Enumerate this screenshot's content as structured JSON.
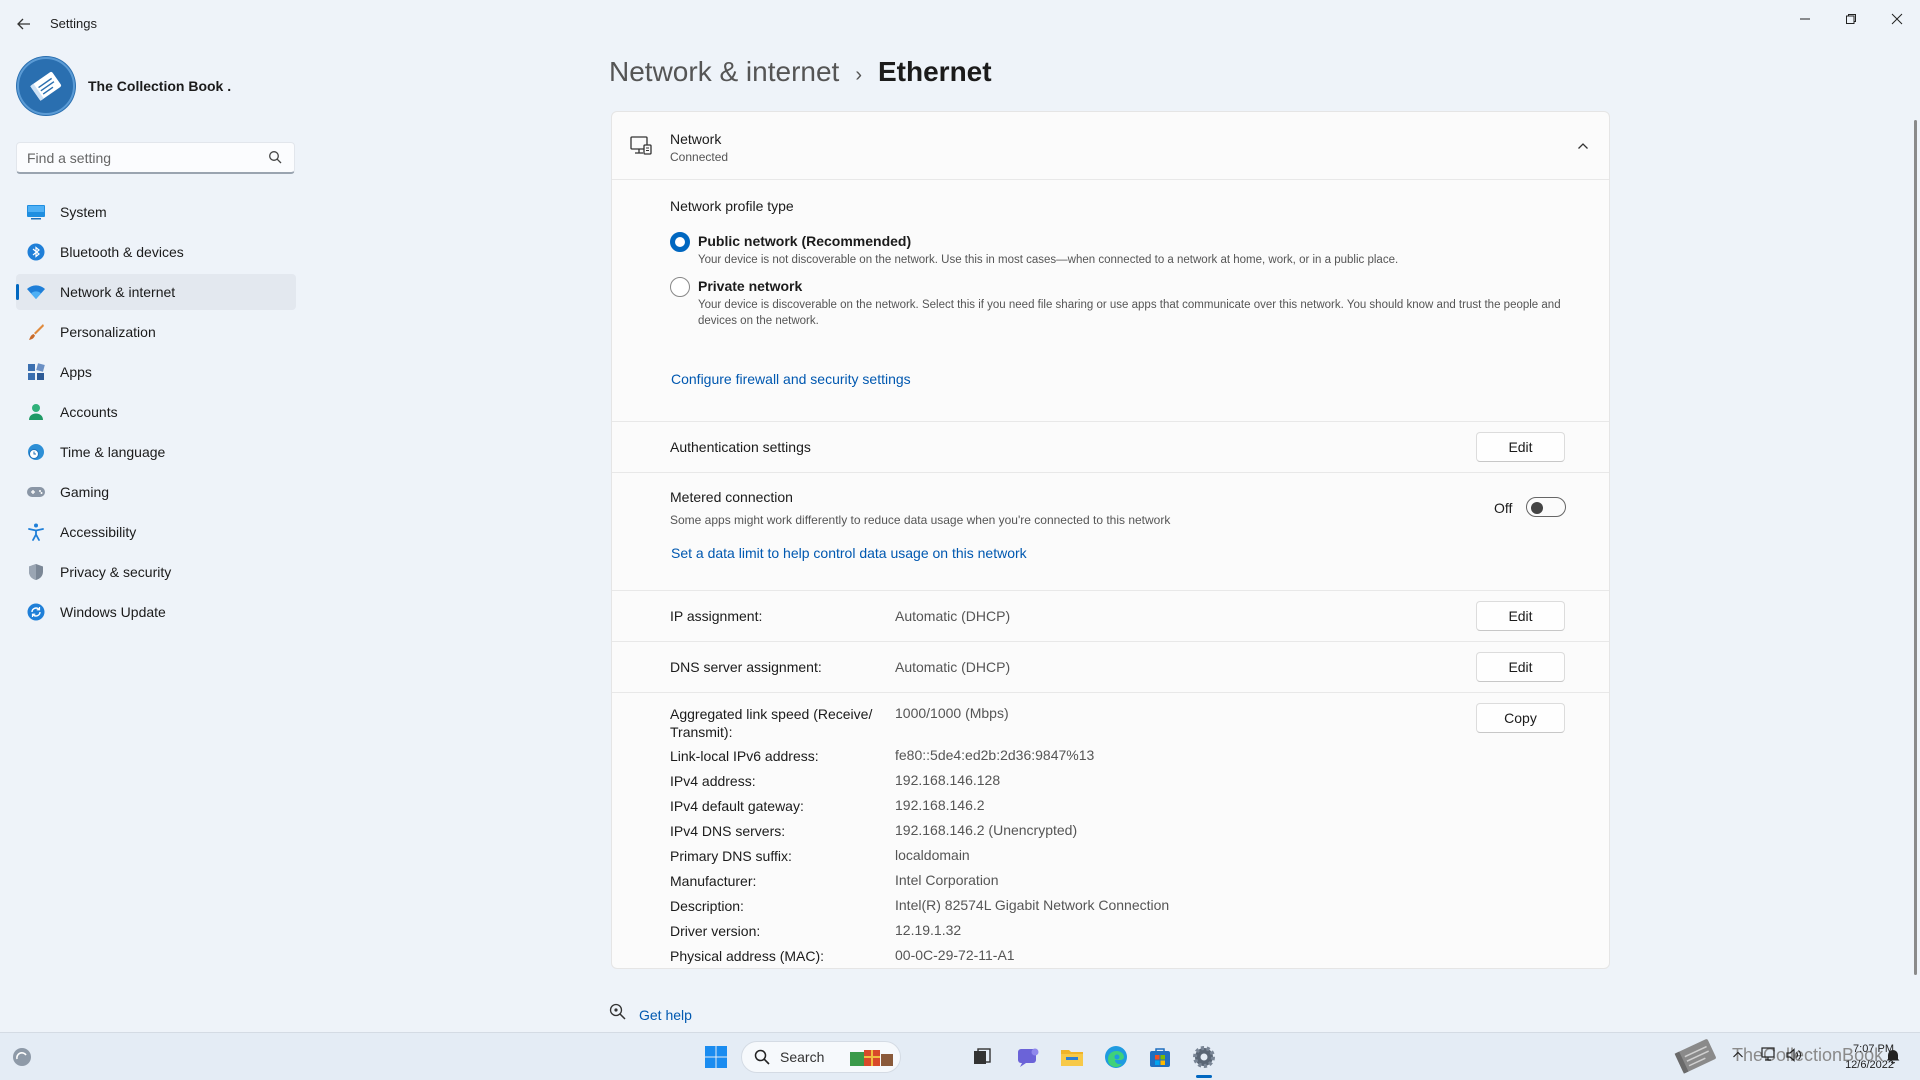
{
  "window": {
    "title": "Settings",
    "back_icon": "back-arrow-icon",
    "minimize_icon": "minimize-icon",
    "maximize_icon": "restore-icon",
    "close_icon": "close-icon"
  },
  "profile": {
    "name": "The Collection Book ."
  },
  "search": {
    "placeholder": "Find a setting"
  },
  "sidebar": {
    "items": [
      {
        "label": "System",
        "icon": "system-icon",
        "active": false
      },
      {
        "label": "Bluetooth & devices",
        "icon": "bluetooth-icon",
        "active": false
      },
      {
        "label": "Network & internet",
        "icon": "wifi-icon",
        "active": true
      },
      {
        "label": "Personalization",
        "icon": "brush-icon",
        "active": false
      },
      {
        "label": "Apps",
        "icon": "apps-icon",
        "active": false
      },
      {
        "label": "Accounts",
        "icon": "person-icon",
        "active": false
      },
      {
        "label": "Time & language",
        "icon": "clock-globe-icon",
        "active": false
      },
      {
        "label": "Gaming",
        "icon": "gamepad-icon",
        "active": false
      },
      {
        "label": "Accessibility",
        "icon": "accessibility-icon",
        "active": false
      },
      {
        "label": "Privacy & security",
        "icon": "shield-icon",
        "active": false
      },
      {
        "label": "Windows Update",
        "icon": "update-icon",
        "active": false
      }
    ]
  },
  "breadcrumb": {
    "parent": "Network & internet",
    "separator": "›",
    "current": "Ethernet"
  },
  "network": {
    "title": "Network",
    "status": "Connected",
    "profile_type_title": "Network profile type",
    "public_label": "Public network (Recommended)",
    "public_desc": "Your device is not discoverable on the network. Use this in most cases—when connected to a network at home, work, or in a public place.",
    "private_label": "Private network",
    "private_desc": "Your device is discoverable on the network. Select this if you need file sharing or use apps that communicate over this network. You should know and trust the people and devices on the network.",
    "selected_profile": "public",
    "firewall_link": "Configure firewall and security settings"
  },
  "auth": {
    "label": "Authentication settings",
    "button": "Edit"
  },
  "metered": {
    "label": "Metered connection",
    "desc": "Some apps might work differently to reduce data usage when you're connected to this network",
    "state": "Off",
    "data_limit_link": "Set a data limit to help control data usage on this network"
  },
  "ip": {
    "label": "IP assignment:",
    "value": "Automatic (DHCP)",
    "button": "Edit"
  },
  "dns": {
    "label": "DNS server assignment:",
    "value": "Automatic (DHCP)",
    "button": "Edit"
  },
  "properties": {
    "copy_button": "Copy",
    "rows": [
      {
        "label": "Aggregated link speed (Receive/ Transmit):",
        "value": "1000/1000 (Mbps)"
      },
      {
        "label": "Link-local IPv6 address:",
        "value": "fe80::5de4:ed2b:2d36:9847%13"
      },
      {
        "label": "IPv4 address:",
        "value": "192.168.146.128"
      },
      {
        "label": "IPv4 default gateway:",
        "value": "192.168.146.2"
      },
      {
        "label": "IPv4 DNS servers:",
        "value": "192.168.146.2 (Unencrypted)"
      },
      {
        "label": "Primary DNS suffix:",
        "value": "localdomain"
      },
      {
        "label": "Manufacturer:",
        "value": "Intel Corporation"
      },
      {
        "label": "Description:",
        "value": "Intel(R) 82574L Gigabit Network Connection"
      },
      {
        "label": "Driver version:",
        "value": "12.19.1.32"
      },
      {
        "label": "Physical address (MAC):",
        "value": "00-0C-29-72-11-A1"
      }
    ]
  },
  "help": {
    "label": "Get help"
  },
  "taskbar": {
    "search_label": "Search",
    "time": "7:07 PM",
    "date": "12/6/2022",
    "watermark": "TheCollectionBook"
  },
  "colors": {
    "accent": "#0067c0",
    "link": "#0058b0",
    "background": "#eef3f9"
  }
}
